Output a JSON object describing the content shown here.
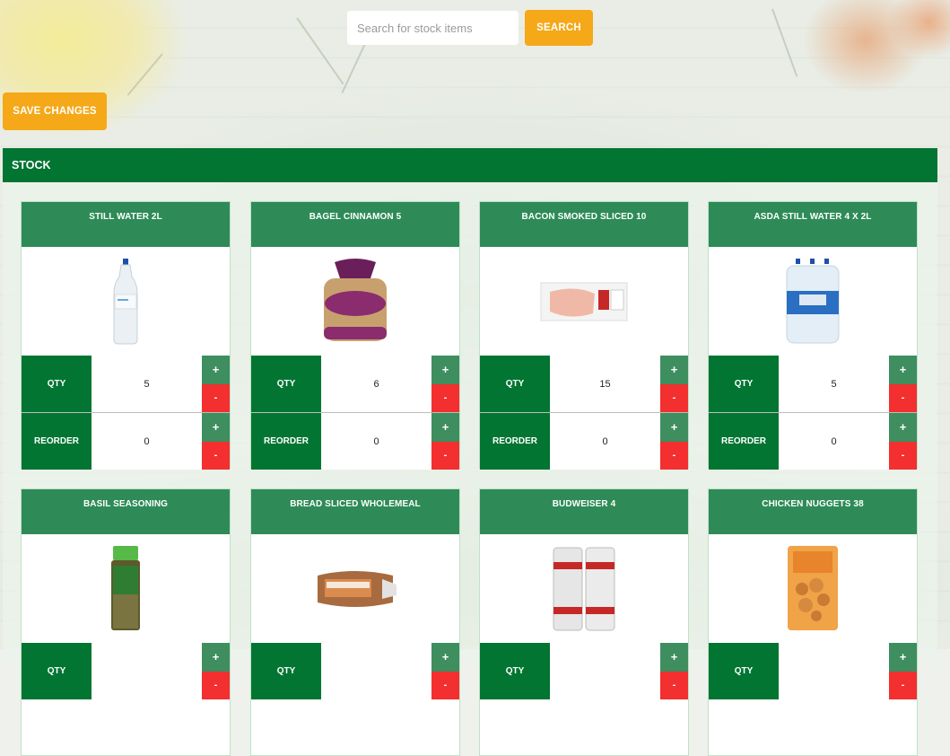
{
  "search": {
    "placeholder": "Search for stock items",
    "value": "",
    "button_label": "SEARCH"
  },
  "toolbar": {
    "save_label": "SAVE CHANGES"
  },
  "stock": {
    "title": "STOCK",
    "qty_label": "QTY",
    "reorder_label": "REORDER",
    "plus_symbol": "+",
    "minus_symbol": "-",
    "items": [
      {
        "name": "STILL WATER 2L",
        "image": "water-bottle-2l-image",
        "qty": "5",
        "reorder": "0"
      },
      {
        "name": "BAGEL CINNAMON 5",
        "image": "bagel-bag-image",
        "qty": "6",
        "reorder": "0"
      },
      {
        "name": "BACON SMOKED SLICED 10",
        "image": "bacon-pack-image",
        "qty": "15",
        "reorder": "0"
      },
      {
        "name": "ASDA STILL WATER 4 X 2L",
        "image": "water-multipack-image",
        "qty": "5",
        "reorder": "0"
      },
      {
        "name": "BASIL SEASONING",
        "image": "basil-jar-image",
        "qty": "",
        "reorder": ""
      },
      {
        "name": "BREAD SLICED WHOLEMEAL",
        "image": "bread-loaf-image",
        "qty": "",
        "reorder": ""
      },
      {
        "name": "BUDWEISER 4",
        "image": "beer-cans-image",
        "qty": "",
        "reorder": ""
      },
      {
        "name": "CHICKEN NUGGETS 38",
        "image": "nuggets-bag-image",
        "qty": "",
        "reorder": ""
      }
    ]
  },
  "colors": {
    "accent": "#f5a818",
    "header_green": "#027532",
    "title_green": "#2e8b57",
    "plus_green": "#3e8e5f",
    "minus_red": "#f32f2f"
  }
}
